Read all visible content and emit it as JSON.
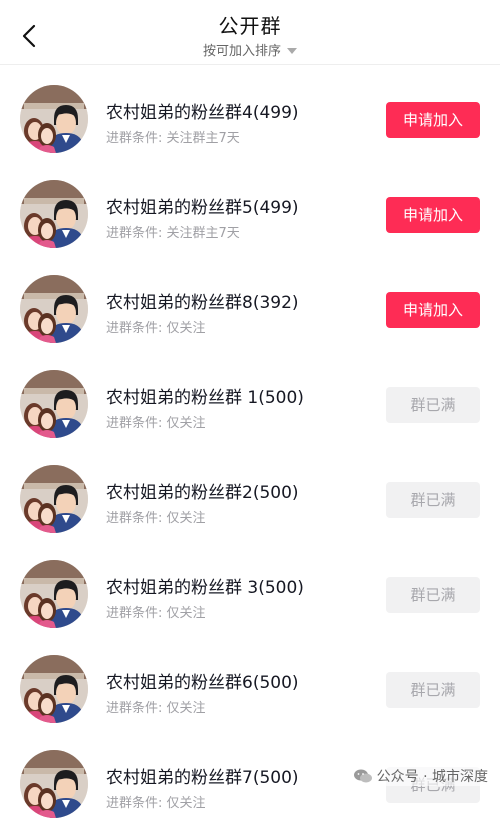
{
  "header": {
    "title": "公开群",
    "sort_label": "按可加入排序"
  },
  "colors": {
    "accent": "#fe2c55",
    "disabled_bg": "#f1f1f2",
    "disabled_text": "#a8a8ad"
  },
  "groups": [
    {
      "name": "农村姐弟的粉丝群4(499)",
      "condition": "进群条件: 关注群主7天",
      "action": "申请加入",
      "state": "join"
    },
    {
      "name": "农村姐弟的粉丝群5(499)",
      "condition": "进群条件: 关注群主7天",
      "action": "申请加入",
      "state": "join"
    },
    {
      "name": "农村姐弟的粉丝群8(392)",
      "condition": "进群条件: 仅关注",
      "action": "申请加入",
      "state": "join"
    },
    {
      "name": "农村姐弟的粉丝群 1(500)",
      "condition": "进群条件: 仅关注",
      "action": "群已满",
      "state": "full"
    },
    {
      "name": "农村姐弟的粉丝群2(500)",
      "condition": "进群条件: 仅关注",
      "action": "群已满",
      "state": "full"
    },
    {
      "name": "农村姐弟的粉丝群 3(500)",
      "condition": "进群条件: 仅关注",
      "action": "群已满",
      "state": "full"
    },
    {
      "name": "农村姐弟的粉丝群6(500)",
      "condition": "进群条件: 仅关注",
      "action": "群已满",
      "state": "full"
    },
    {
      "name": "农村姐弟的粉丝群7(500)",
      "condition": "进群条件: 仅关注",
      "action": "群已满",
      "state": "full"
    }
  ],
  "watermark": {
    "text": "公众号 · 城市深度",
    "icon": "wechat-icon"
  }
}
